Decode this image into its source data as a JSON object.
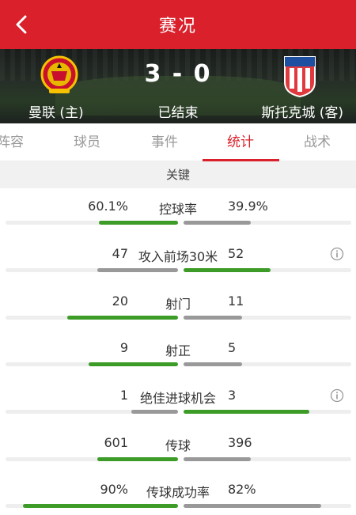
{
  "header": {
    "title": "赛况",
    "back_icon": "chevron-left-icon"
  },
  "match": {
    "home_team": "曼联 (主)",
    "away_team": "斯托克城 (客)",
    "score": "3 - 0",
    "status": "已结束"
  },
  "tabs": [
    {
      "label": "阵容",
      "active": false
    },
    {
      "label": "球员",
      "active": false
    },
    {
      "label": "事件",
      "active": false
    },
    {
      "label": "统计",
      "active": true
    },
    {
      "label": "战术",
      "active": false
    }
  ],
  "section": {
    "title": "关键"
  },
  "stats": [
    {
      "label": "控球率",
      "home": "60.1%",
      "away": "39.9%",
      "home_value": 60.1,
      "away_value": 39.9,
      "home_share": 0.46,
      "away_share": 0.4,
      "info": false
    },
    {
      "label": "攻入前场30米",
      "home": "47",
      "away": "52",
      "home_value": 47,
      "away_value": 52,
      "home_share": 0.47,
      "away_share": 0.52,
      "info": true
    },
    {
      "label": "射门",
      "home": "20",
      "away": "11",
      "home_value": 20,
      "away_value": 11,
      "home_share": 0.64,
      "away_share": 0.35,
      "info": false
    },
    {
      "label": "射正",
      "home": "9",
      "away": "5",
      "home_value": 9,
      "away_value": 5,
      "home_share": 0.52,
      "away_share": 0.35,
      "info": false
    },
    {
      "label": "绝佳进球机会",
      "home": "1",
      "away": "3",
      "home_value": 1,
      "away_value": 3,
      "home_share": 0.27,
      "away_share": 0.75,
      "info": true
    },
    {
      "label": "传球",
      "home": "601",
      "away": "396",
      "home_value": 601,
      "away_value": 396,
      "home_share": 0.47,
      "away_share": 0.4,
      "info": false
    },
    {
      "label": "传球成功率",
      "home": "90%",
      "away": "82%",
      "home_value": 90,
      "away_value": 82,
      "home_share": 0.9,
      "away_share": 0.82,
      "info": false
    }
  ],
  "colors": {
    "brand_red": "#d9202b",
    "leading_green": "#3d9c28",
    "trailing_grey": "#999999"
  }
}
